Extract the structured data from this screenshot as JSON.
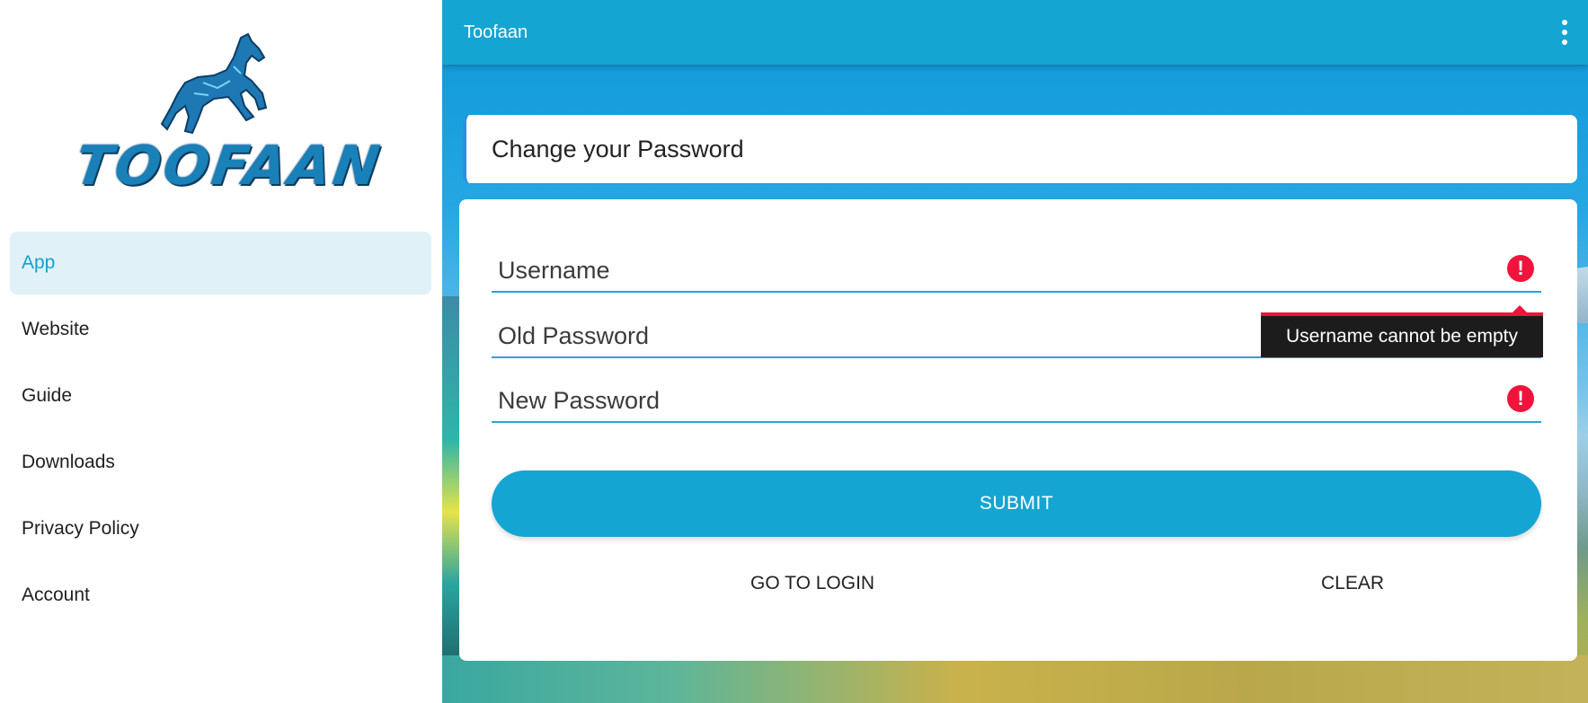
{
  "sidebar": {
    "logo_text": "TOOFAAN",
    "items": [
      {
        "label": "App",
        "active": true
      },
      {
        "label": "Website",
        "active": false
      },
      {
        "label": "Guide",
        "active": false
      },
      {
        "label": "Downloads",
        "active": false
      },
      {
        "label": "Privacy Policy",
        "active": false
      },
      {
        "label": "Account",
        "active": false
      }
    ]
  },
  "appbar": {
    "title": "Toofaan",
    "menu_icon": "more-vert-icon"
  },
  "page": {
    "title": "Change your Password"
  },
  "form": {
    "username": {
      "placeholder": "Username",
      "value": "",
      "error_icon": "error-icon"
    },
    "old_password": {
      "placeholder": "Old Password",
      "value": ""
    },
    "new_password": {
      "placeholder": "New Password",
      "value": "",
      "error_icon": "error-icon"
    },
    "tooltip": "Username cannot be empty",
    "submit_label": "SUBMIT",
    "go_to_login_label": "GO TO LOGIN",
    "clear_label": "CLEAR"
  },
  "colors": {
    "primary": "#14a5d3",
    "error": "#f0143c",
    "active_nav_bg": "#e0f1f8"
  }
}
